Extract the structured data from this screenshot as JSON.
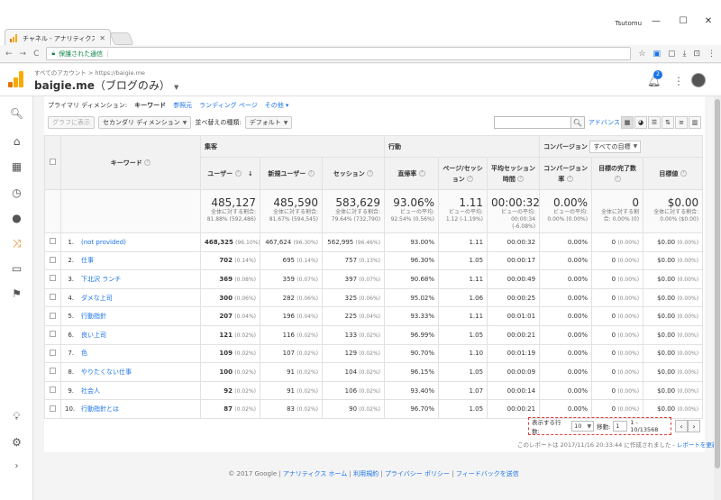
{
  "browser": {
    "tab_title": "チャネル - アナリティクス",
    "user_name": "Tsutomu",
    "security_label": "保護された通信",
    "url": "https://baigie.me"
  },
  "header": {
    "breadcrumb": "すべてのアカウント > https://baigie.me",
    "property_name": "baigie.me",
    "view_name": "（ブログのみ）",
    "notification_count": "2"
  },
  "toolbar": {
    "primary_dim_label": "プライマリ ディメンション:",
    "primary_dim_active": "キーワード",
    "primary_dim_links": [
      "参照元",
      "ランディング ページ",
      "その他"
    ],
    "plot_rows": "グラフに表示",
    "secondary_dim": "セカンダリ ディメンション",
    "sort_type_label": "並べ替えの種類:",
    "sort_type_value": "デフォルト",
    "advanced": "アドバンス"
  },
  "table": {
    "groups": {
      "acquisition": "集客",
      "behavior": "行動",
      "conversion": "コンバージョン",
      "goal_select": "すべての目標"
    },
    "columns": {
      "keyword": "キーワード",
      "users": "ユーザー",
      "new_users": "新規ユーザー",
      "sessions": "セッション",
      "bounce": "直帰率",
      "pps": "ページ/セッション",
      "duration": "平均セッション時間",
      "conv_rate": "コンバージョン率",
      "goal_comp": "目標の完了数",
      "goal_value": "目標値"
    },
    "totals": {
      "users": "485,127",
      "users_sub": "全体に対する割合: 81.88% (592,486)",
      "new_users": "485,590",
      "new_users_sub": "全体に対する割合: 81.67% (594,545)",
      "sessions": "583,629",
      "sessions_sub": "全体に対する割合: 79.64% (732,790)",
      "bounce": "93.06%",
      "bounce_sub": "ビューの平均: 92.54% (0.56%)",
      "pps": "1.11",
      "pps_sub": "ビューの平均: 1.12 (-1.19%)",
      "duration": "00:00:32",
      "duration_sub": "ビューの平均: 00:00:34 (-6.08%)",
      "conv_rate": "0.00%",
      "conv_rate_sub": "ビューの平均: 0.00% (0.00%)",
      "goal_comp": "0",
      "goal_comp_sub": "全体に対する割合: 0.00% (0)",
      "goal_value": "$0.00",
      "goal_value_sub": "全体に対する割合: 0.00% ($0.00)"
    },
    "rows": [
      {
        "n": "1.",
        "kw": "(not provided)",
        "users": "468,325",
        "users_p": "(96.10%)",
        "new_users": "467,624",
        "new_users_p": "(96.30%)",
        "sessions": "562,995",
        "sessions_p": "(96.46%)",
        "bounce": "93.00%",
        "pps": "1.11",
        "dur": "00:00:32",
        "conv": "0.00%",
        "goal": "0",
        "goal_p": "(0.00%)",
        "val": "$0.00",
        "val_p": "(0.00%)"
      },
      {
        "n": "2.",
        "kw": "仕事",
        "users": "702",
        "users_p": "(0.14%)",
        "new_users": "695",
        "new_users_p": "(0.14%)",
        "sessions": "757",
        "sessions_p": "(0.13%)",
        "bounce": "96.30%",
        "pps": "1.05",
        "dur": "00:00:17",
        "conv": "0.00%",
        "goal": "0",
        "goal_p": "(0.00%)",
        "val": "$0.00",
        "val_p": "(0.00%)"
      },
      {
        "n": "3.",
        "kw": "下北沢 ランチ",
        "users": "369",
        "users_p": "(0.08%)",
        "new_users": "359",
        "new_users_p": "(0.07%)",
        "sessions": "397",
        "sessions_p": "(0.07%)",
        "bounce": "90.68%",
        "pps": "1.11",
        "dur": "00:00:49",
        "conv": "0.00%",
        "goal": "0",
        "goal_p": "(0.00%)",
        "val": "$0.00",
        "val_p": "(0.00%)"
      },
      {
        "n": "4.",
        "kw": "ダメな上司",
        "users": "300",
        "users_p": "(0.06%)",
        "new_users": "282",
        "new_users_p": "(0.06%)",
        "sessions": "325",
        "sessions_p": "(0.06%)",
        "bounce": "95.02%",
        "pps": "1.06",
        "dur": "00:00:25",
        "conv": "0.00%",
        "goal": "0",
        "goal_p": "(0.00%)",
        "val": "$0.00",
        "val_p": "(0.00%)"
      },
      {
        "n": "5.",
        "kw": "行動指針",
        "users": "207",
        "users_p": "(0.04%)",
        "new_users": "196",
        "new_users_p": "(0.04%)",
        "sessions": "225",
        "sessions_p": "(0.04%)",
        "bounce": "93.33%",
        "pps": "1.11",
        "dur": "00:01:01",
        "conv": "0.00%",
        "goal": "0",
        "goal_p": "(0.00%)",
        "val": "$0.00",
        "val_p": "(0.00%)"
      },
      {
        "n": "6.",
        "kw": "良い上司",
        "users": "121",
        "users_p": "(0.02%)",
        "new_users": "116",
        "new_users_p": "(0.02%)",
        "sessions": "133",
        "sessions_p": "(0.02%)",
        "bounce": "96.99%",
        "pps": "1.05",
        "dur": "00:00:21",
        "conv": "0.00%",
        "goal": "0",
        "goal_p": "(0.00%)",
        "val": "$0.00",
        "val_p": "(0.00%)"
      },
      {
        "n": "7.",
        "kw": "色",
        "users": "109",
        "users_p": "(0.02%)",
        "new_users": "107",
        "new_users_p": "(0.02%)",
        "sessions": "129",
        "sessions_p": "(0.02%)",
        "bounce": "90.70%",
        "pps": "1.10",
        "dur": "00:01:19",
        "conv": "0.00%",
        "goal": "0",
        "goal_p": "(0.00%)",
        "val": "$0.00",
        "val_p": "(0.00%)"
      },
      {
        "n": "8.",
        "kw": "やりたくない仕事",
        "users": "100",
        "users_p": "(0.02%)",
        "new_users": "91",
        "new_users_p": "(0.02%)",
        "sessions": "104",
        "sessions_p": "(0.02%)",
        "bounce": "96.15%",
        "pps": "1.05",
        "dur": "00:00:09",
        "conv": "0.00%",
        "goal": "0",
        "goal_p": "(0.00%)",
        "val": "$0.00",
        "val_p": "(0.00%)"
      },
      {
        "n": "9.",
        "kw": "社会人",
        "users": "92",
        "users_p": "(0.02%)",
        "new_users": "91",
        "new_users_p": "(0.02%)",
        "sessions": "106",
        "sessions_p": "(0.02%)",
        "bounce": "93.40%",
        "pps": "1.07",
        "dur": "00:00:14",
        "conv": "0.00%",
        "goal": "0",
        "goal_p": "(0.00%)",
        "val": "$0.00",
        "val_p": "(0.00%)"
      },
      {
        "n": "10.",
        "kw": "行動指針とは",
        "users": "87",
        "users_p": "(0.02%)",
        "new_users": "83",
        "new_users_p": "(0.02%)",
        "sessions": "90",
        "sessions_p": "(0.02%)",
        "bounce": "96.70%",
        "pps": "1.05",
        "dur": "00:00:21",
        "conv": "0.00%",
        "goal": "0",
        "goal_p": "(0.00%)",
        "val": "$0.00",
        "val_p": "(0.00%)"
      }
    ]
  },
  "pager": {
    "rows_label": "表示する行数:",
    "rows_value": "10",
    "goto_label": "移動:",
    "goto_value": "1",
    "range": "1 - 10/13568"
  },
  "created": {
    "text": "このレポートは 2017/11/16 20:33:44 に作成されました -",
    "refresh": "レポートを更新"
  },
  "footer": {
    "copyright": "© 2017 Google",
    "links": [
      "アナリティクス ホーム",
      "利用規約",
      "プライバシー ポリシー",
      "フィードバックを送信"
    ]
  }
}
